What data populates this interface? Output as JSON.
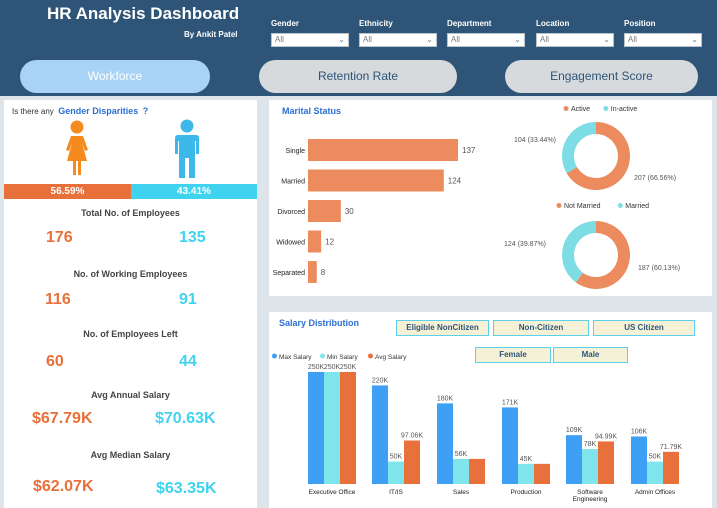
{
  "header": {
    "title": "HR Analysis Dashboard",
    "author": "By Ankit Patel",
    "filters": [
      {
        "label": "Gender",
        "value": "All"
      },
      {
        "label": "Ethnicity",
        "value": "All"
      },
      {
        "label": "Department",
        "value": "All"
      },
      {
        "label": "Location",
        "value": "All"
      },
      {
        "label": "Position",
        "value": "All"
      }
    ]
  },
  "tabs": [
    {
      "label": "Workforce",
      "active": true
    },
    {
      "label": "Retention Rate",
      "active": false
    },
    {
      "label": "Engagement Score",
      "active": false
    }
  ],
  "gender": {
    "question_prefix": "Is there any",
    "question_highlight": "Gender Disparities",
    "question_suffix": "?",
    "female_pct": "56.59%",
    "male_pct": "43.41%",
    "female_share": 0.5659,
    "colors": {
      "female": "#e8703a",
      "male": "#3fd3f0"
    }
  },
  "kpis": [
    {
      "title": "Total No. of Employees",
      "female": "176",
      "male": "135"
    },
    {
      "title": "No. of Working Employees",
      "female": "116",
      "male": "91"
    },
    {
      "title": "No. of Employees Left",
      "female": "60",
      "male": "44"
    },
    {
      "title": "Avg Annual Salary",
      "female": "$67.79K",
      "male": "$70.63K"
    },
    {
      "title": "Avg Median Salary",
      "female": "$62.07K",
      "male": "$63.35K"
    }
  ],
  "marital": {
    "title": "Marital Status",
    "bar_color": "#ec8b5e"
  },
  "salary": {
    "title": "Salary Distribution",
    "slicers_row1": [
      "Eligible NonCitizen",
      "Non-Citizen",
      "US Citizen"
    ],
    "slicers_row2": [
      "Female",
      "Male"
    ]
  },
  "chart_data": [
    {
      "type": "bar",
      "orientation": "horizontal",
      "categories": [
        "Single",
        "Married",
        "Divorced",
        "Widowed",
        "Separated"
      ],
      "values": [
        137,
        124,
        30,
        12,
        8
      ]
    },
    {
      "type": "pie",
      "donut": true,
      "legend": [
        "Active",
        "In-active"
      ],
      "values": [
        207,
        104
      ],
      "labels": [
        "207 (66.56%)",
        "104 (33.44%)"
      ],
      "colors": [
        "#ec8b5e",
        "#7edde4"
      ]
    },
    {
      "type": "pie",
      "donut": true,
      "legend": [
        "Not Married",
        "Married"
      ],
      "values": [
        187,
        124
      ],
      "labels": [
        "187 (60.13%)",
        "124 (39.87%)"
      ],
      "colors": [
        "#ec8b5e",
        "#7edde4"
      ]
    },
    {
      "type": "bar",
      "categories": [
        "Executive Office",
        "IT/IS",
        "Sales",
        "Production",
        "Software Engineering",
        "Admin Offices"
      ],
      "series": [
        {
          "name": "Max Salary",
          "color": "#3ea0f5",
          "values": [
            250,
            220,
            180,
            171,
            109,
            106
          ],
          "labels": [
            "250K",
            "220K",
            "180K",
            "171K",
            "109K",
            "106K"
          ]
        },
        {
          "name": "Min Salary",
          "color": "#7fe4ec",
          "values": [
            250,
            50,
            56,
            45,
            78,
            50
          ],
          "labels": [
            "250K",
            "50K",
            "56K",
            "45K",
            "78K",
            "50K"
          ]
        },
        {
          "name": "Avg Salary",
          "color": "#e8703a",
          "values": [
            250,
            97.06,
            56,
            45,
            94.99,
            71.79
          ],
          "labels": [
            "250K",
            "97.06K",
            "",
            "",
            "94.99K",
            "71.79K"
          ]
        }
      ]
    }
  ]
}
